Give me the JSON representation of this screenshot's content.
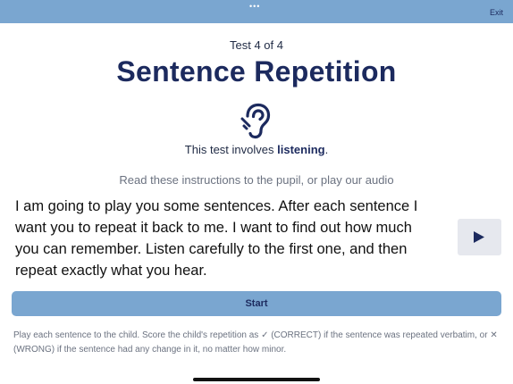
{
  "topbar": {
    "menu_dots": "•••",
    "exit_label": "Exit"
  },
  "header": {
    "step": "Test 4 of 4",
    "title": "Sentence Repetition"
  },
  "ear_icon": "ear-listening-icon",
  "involves": {
    "prefix": "This test involves ",
    "emphasis": "listening",
    "suffix": "."
  },
  "instructions_prompt": "Read these instructions to the pupil, or play our audio",
  "instructions_text": "I am going to play you some sentences.  After each sentence I want you to repeat it back to me. I want to find out how much you can remember.  Listen carefully to the first one, and then repeat exactly what you hear.",
  "play_button": {
    "icon": "play-icon"
  },
  "start_button": {
    "label": "Start"
  },
  "footer_note": "Play each sentence to the child. Score the child's repetition as ✓ (CORRECT) if the sentence was repeated verbatim, or ✕ (WRONG) if the sentence had any change in it, no matter how minor.",
  "colors": {
    "accent": "#7aa6d0",
    "heading": "#1c2a5e",
    "muted": "#6b7280",
    "play_bg": "#e6e8ee"
  }
}
